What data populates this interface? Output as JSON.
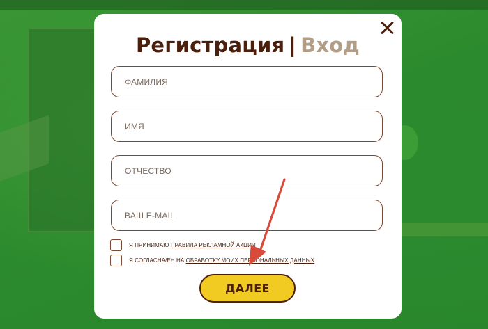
{
  "modal": {
    "title_register": "Регистрация",
    "title_separator": "|",
    "title_login": "Вход",
    "close_icon": "close-icon"
  },
  "form": {
    "fields": [
      {
        "placeholder": "ФАМИЛИЯ",
        "value": ""
      },
      {
        "placeholder": "ИМЯ",
        "value": ""
      },
      {
        "placeholder": "ОТЧЕСТВО",
        "value": ""
      },
      {
        "placeholder": "ВАШ E-MAIL",
        "value": ""
      }
    ],
    "consent_rules": {
      "prefix": "Я ПРИНИМАЮ ",
      "link": "ПРАВИЛА РЕКЛАМНОЙ АКЦИИ",
      "checked": false
    },
    "consent_data": {
      "prefix": "Я СОГЛАСНА/ЕН НА ",
      "link": "ОБРАБОТКУ МОИХ ПЕРСОНАЛЬНЫХ ДАННЫХ",
      "checked": false
    },
    "submit_label": "ДАЛЕЕ"
  },
  "colors": {
    "brown": "#4a1f0e",
    "muted_tab": "#b29d87",
    "button_yellow": "#f2cb22",
    "backdrop_green": "#2f8f2f",
    "annotation_arrow": "#d84a3a"
  }
}
